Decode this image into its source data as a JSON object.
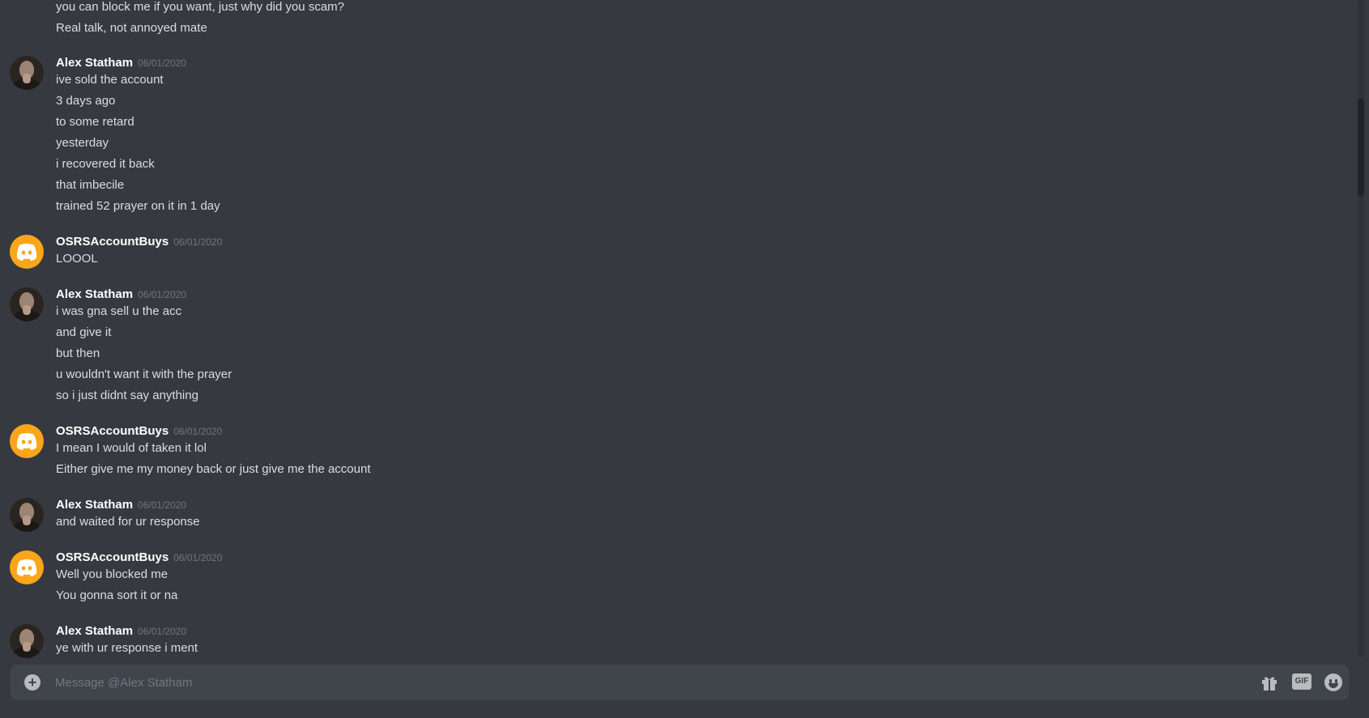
{
  "chat": {
    "top_lines": [
      "you can block me if you want, just why did you scam?",
      "Real talk, not annoyed mate"
    ],
    "groups": [
      {
        "author": "Alex Statham",
        "timestamp": "06/01/2020",
        "avatar": "user-photo-avatar",
        "lines": [
          "ive sold the account",
          "3 days ago",
          "to some retard",
          "yesterday",
          "i recovered it back",
          "that imbecile",
          "trained 52 prayer on it in 1 day"
        ]
      },
      {
        "author": "OSRSAccountBuys",
        "timestamp": "06/01/2020",
        "avatar": "discord-logo-avatar",
        "lines": [
          "LOOOL"
        ]
      },
      {
        "author": "Alex Statham",
        "timestamp": "06/01/2020",
        "avatar": "user-photo-avatar",
        "lines": [
          "i was gna sell u the acc",
          "and give it",
          "but then",
          "u wouldn't want it with the prayer",
          "so i just didnt say anything"
        ]
      },
      {
        "author": "OSRSAccountBuys",
        "timestamp": "06/01/2020",
        "avatar": "discord-logo-avatar",
        "lines": [
          "I mean I would of taken it lol",
          "Either give me my money back or just give me the account"
        ]
      },
      {
        "author": "Alex Statham",
        "timestamp": "06/01/2020",
        "avatar": "user-photo-avatar",
        "lines": [
          "and waited for ur response"
        ]
      },
      {
        "author": "OSRSAccountBuys",
        "timestamp": "06/01/2020",
        "avatar": "discord-logo-avatar",
        "lines": [
          "Well you blocked me",
          "You gonna sort it or na"
        ]
      },
      {
        "author": "Alex Statham",
        "timestamp": "06/01/2020",
        "avatar": "user-photo-avatar",
        "lines": [
          "ye with ur response i ment"
        ]
      }
    ]
  },
  "composer": {
    "placeholder": "Message @Alex Statham",
    "value": "",
    "icons": [
      "add-attachment-icon",
      "gift-icon",
      "gif-icon",
      "emoji-icon"
    ],
    "gif_label": "GIF"
  },
  "colors": {
    "background": "#36393f",
    "input_bg": "#40444b",
    "text": "#dcddde",
    "author": "#ffffff",
    "timestamp": "#72767d",
    "discord_avatar": "#faa61a"
  }
}
